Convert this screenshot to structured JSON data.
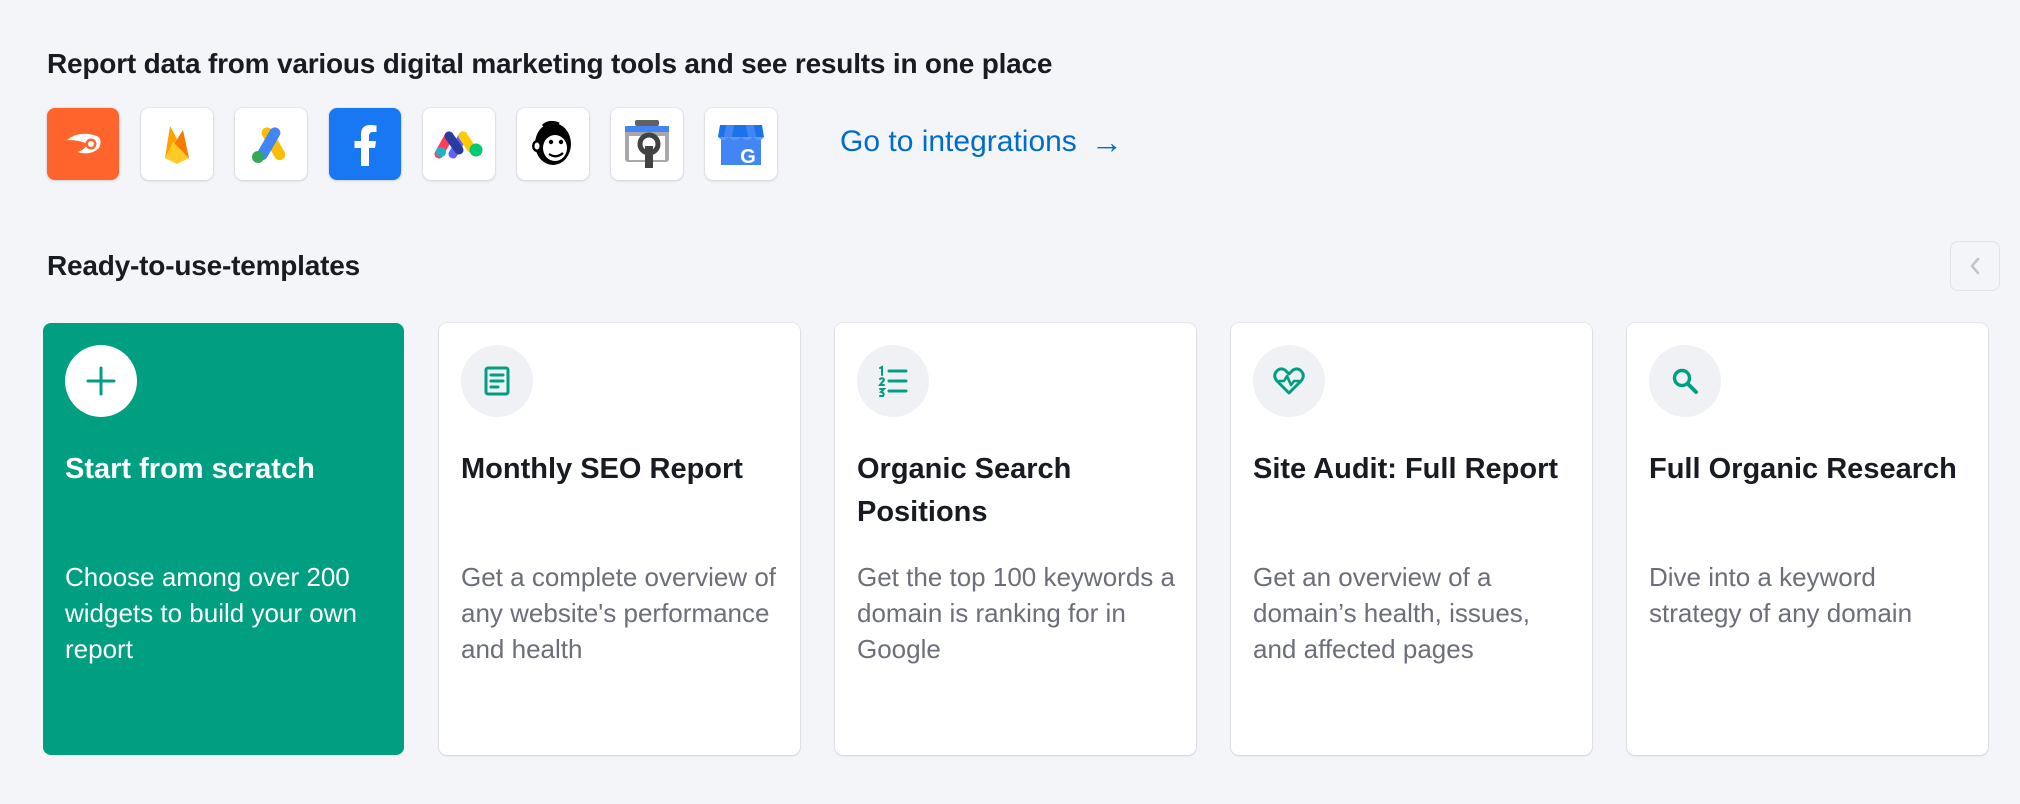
{
  "integrations": {
    "title": "Report data from various digital marketing tools and see results in one place",
    "icons": [
      {
        "name": "semrush-icon",
        "color": "#ff642d"
      },
      {
        "name": "firebase-icon"
      },
      {
        "name": "google-ads-icon"
      },
      {
        "name": "facebook-icon",
        "color": "#1877f2"
      },
      {
        "name": "monday-icon"
      },
      {
        "name": "mailchimp-icon"
      },
      {
        "name": "google-search-console-icon"
      },
      {
        "name": "google-business-profile-icon"
      }
    ],
    "link_label": "Go to integrations",
    "link_arrow": "→"
  },
  "templates": {
    "title": "Ready-to-use-templates",
    "prev_icon": "chevron-left-icon",
    "cards": [
      {
        "title": "Start from scratch",
        "description": "Choose among over 200 widgets to build your own report",
        "icon": "plus-icon",
        "accent": "#009f81"
      },
      {
        "title": "Monthly SEO Report",
        "description": "Get a complete overview of any website's performance and health",
        "icon": "document-icon"
      },
      {
        "title": "Organic Search Positions",
        "description": "Get the top 100 keywords a domain is ranking for in Google",
        "icon": "ordered-list-icon"
      },
      {
        "title": "Site Audit: Full Report",
        "description": "Get an overview of a domain’s health, issues, and affected pages",
        "icon": "heart-pulse-icon"
      },
      {
        "title": "Full Organic Research",
        "description": "Dive into a keyword strategy of any domain",
        "icon": "search-icon"
      }
    ]
  }
}
